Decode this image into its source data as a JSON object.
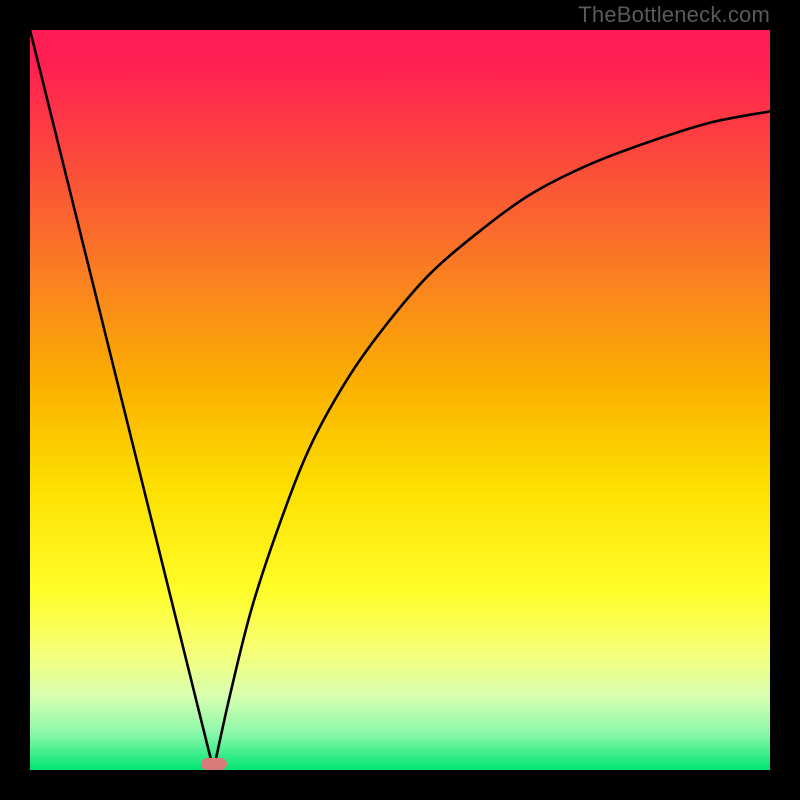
{
  "attribution": "TheBottleneck.com",
  "chart_data": {
    "type": "line",
    "title": "",
    "xlabel": "",
    "ylabel": "",
    "xlim": [
      0,
      100
    ],
    "ylim": [
      0,
      100
    ],
    "grid": false,
    "legend": false,
    "gradient_stops": [
      {
        "pos": 0.0,
        "color": "#ff1a56"
      },
      {
        "pos": 0.06,
        "color": "#ff2350"
      },
      {
        "pos": 0.18,
        "color": "#fb4b3a"
      },
      {
        "pos": 0.32,
        "color": "#fa7b24"
      },
      {
        "pos": 0.48,
        "color": "#fbb000"
      },
      {
        "pos": 0.62,
        "color": "#fde000"
      },
      {
        "pos": 0.76,
        "color": "#fffd2a"
      },
      {
        "pos": 0.84,
        "color": "#f6ff77"
      },
      {
        "pos": 0.9,
        "color": "#d8ffb0"
      },
      {
        "pos": 0.95,
        "color": "#8cf8aa"
      },
      {
        "pos": 1.0,
        "color": "#00e573"
      }
    ],
    "series": [
      {
        "name": "left-descent",
        "x": [
          0,
          24.8
        ],
        "y": [
          100,
          0
        ]
      },
      {
        "name": "right-ascent",
        "x": [
          24.8,
          27,
          30,
          34,
          38,
          43,
          48,
          54,
          61,
          68,
          76,
          84,
          92,
          100
        ],
        "y": [
          0,
          10,
          22,
          34,
          44,
          53,
          60,
          67,
          73,
          78,
          82,
          85,
          87.5,
          89
        ]
      }
    ],
    "annotations": [
      {
        "name": "min-marker",
        "x": 24.8,
        "y": 0.8,
        "color": "#d97b7b",
        "shape": "pill"
      }
    ]
  }
}
